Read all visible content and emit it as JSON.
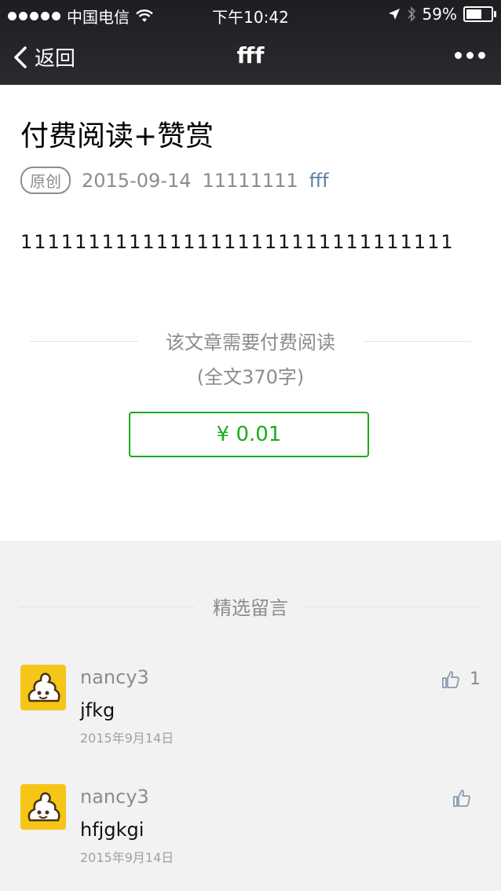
{
  "status_bar": {
    "carrier": "中国电信",
    "time": "下午10:42",
    "battery": "59%"
  },
  "nav": {
    "back_label": "返回",
    "title": "fff"
  },
  "article": {
    "title": "付费阅读+赞赏",
    "badge": "原创",
    "date": "2015-09-14",
    "account": "11111111",
    "author": "fff",
    "content": "11111111111111111111111111111111"
  },
  "paywall": {
    "message": "该文章需要付费阅读",
    "word_count": "(全文370字)",
    "price": "¥ 0.01"
  },
  "comments": {
    "section_title": "精选留言",
    "items": [
      {
        "nickname": "nancy3",
        "text": "jfkg",
        "date": "2015年9月14日",
        "likes": "1"
      },
      {
        "nickname": "nancy3",
        "text": "hfjgkgi",
        "date": "2015年9月14日",
        "likes": ""
      }
    ]
  },
  "colors": {
    "accent_green": "#1aad19",
    "link_blue": "#607fa6",
    "avatar_yellow": "#f5c518"
  }
}
